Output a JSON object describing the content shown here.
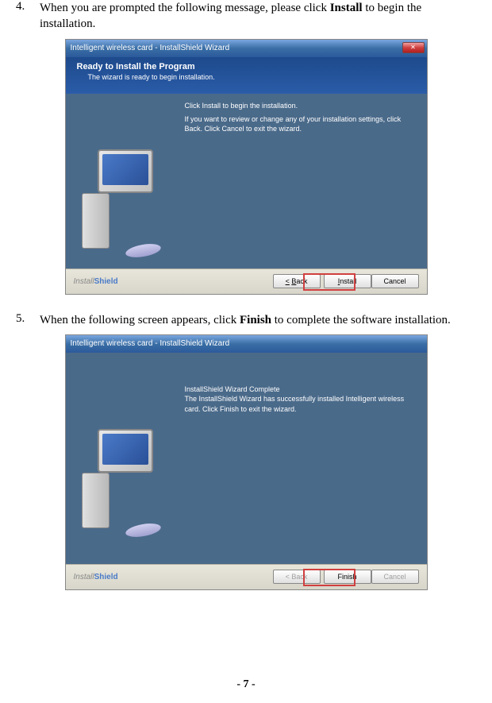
{
  "step4": {
    "number": "4.",
    "text_before": "When you are prompted the following message, please click ",
    "text_bold": "Install",
    "text_after": " to begin the installation."
  },
  "step5": {
    "number": "5.",
    "text_before": "When the following screen appears, click ",
    "text_bold": "Finish",
    "text_after": " to complete the software installation."
  },
  "dialog1": {
    "title": "Intelligent wireless card - InstallShield Wizard",
    "banner_title": "Ready to Install the Program",
    "banner_sub": "The wizard is ready to begin installation.",
    "body_line1": "Click Install to begin the installation.",
    "body_line2": "If you want to review or change any of your installation settings, click Back. Click Cancel to exit the wizard.",
    "btn_back": "< Back",
    "btn_install": "Install",
    "btn_cancel": "Cancel",
    "brand_install": "Install",
    "brand_shield": "Shield"
  },
  "dialog2": {
    "title": "Intelligent wireless card - InstallShield Wizard",
    "heading": "InstallShield Wizard Complete",
    "body": "The InstallShield Wizard has successfully installed Intelligent wireless card.  Click Finish to exit the wizard.",
    "btn_back": "< Back",
    "btn_finish": "Finish",
    "btn_cancel": "Cancel",
    "brand_install": "Install",
    "brand_shield": "Shield"
  },
  "page_number": "- 7 -"
}
